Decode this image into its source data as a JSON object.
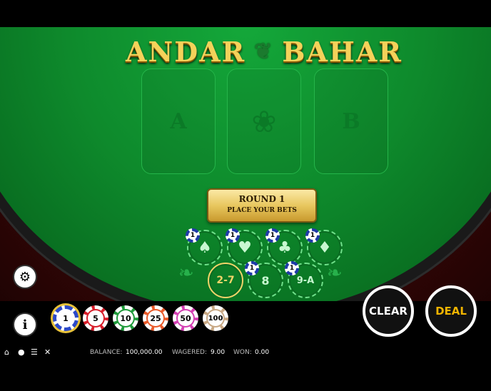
{
  "title": {
    "left": "ANDAR",
    "right": "BAHAR"
  },
  "slots": [
    {
      "label": "A"
    },
    {
      "label": ""
    },
    {
      "label": "B"
    }
  ],
  "round": {
    "line1": "ROUND 1",
    "line2": "PLACE YOUR BETS"
  },
  "bet_spots": [
    {
      "name": "spade",
      "symbol": "♠",
      "bet": "1"
    },
    {
      "name": "heart",
      "symbol": "♥",
      "bet": "1"
    },
    {
      "name": "club",
      "symbol": "♣",
      "bet": "1"
    },
    {
      "name": "diamond",
      "symbol": "♦",
      "bet": "1"
    },
    {
      "name": "range-2-7",
      "symbol": "2-7",
      "bet": ""
    },
    {
      "name": "eight",
      "symbol": "8",
      "bet": "1"
    },
    {
      "name": "range-9-a",
      "symbol": "9-A",
      "bet": "1"
    }
  ],
  "chips": [
    {
      "value": "1",
      "color": "#2b49c9"
    },
    {
      "value": "5",
      "color": "#d81e2a"
    },
    {
      "value": "10",
      "color": "#1f9a3a"
    },
    {
      "value": "25",
      "color": "#ea5a2a"
    },
    {
      "value": "50",
      "color": "#d43fb3"
    },
    {
      "value": "100",
      "color": "#c8a884"
    }
  ],
  "selected_chip": "1",
  "buttons": {
    "clear": "CLEAR",
    "deal": "DEAL"
  },
  "status": {
    "balance_label": "BALANCE:",
    "balance": "100,000.00",
    "wagered_label": "WAGERED:",
    "wagered": "9.00",
    "won_label": "WON:",
    "won": "0.00"
  },
  "icons": [
    "settings-icon",
    "info-icon",
    "home-icon",
    "user-icon",
    "menu-icon",
    "mute-icon"
  ],
  "colors": {
    "felt": "#0e8a2c",
    "gold": "#f4d25a",
    "deal": "#f0b400",
    "clear": "#ffffff"
  }
}
